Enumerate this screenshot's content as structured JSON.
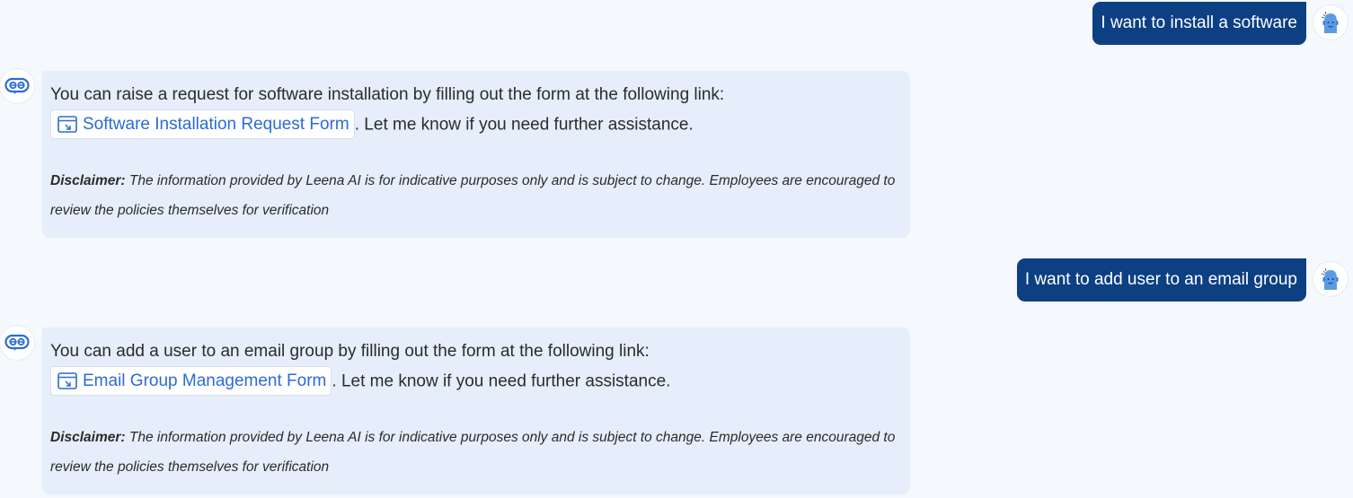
{
  "conversation": {
    "messages": [
      {
        "role": "user",
        "text": "I want to install a software",
        "avatar_icon": "user-mascot-icon"
      },
      {
        "role": "bot",
        "avatar_icon": "leena-ai-logo-icon",
        "intro": "You can raise a request for software installation by filling out the form at the following link:",
        "link_label": "Software Installation Request Form",
        "link_icon": "form-link-icon",
        "after_link": ". Let me know if you need further assistance.",
        "disclaimer_label": "Disclaimer:",
        "disclaimer_text": " The information provided by Leena AI is for indicative purposes only and is subject to change. Employees are encouraged to review the policies themselves for verification"
      },
      {
        "role": "user",
        "text": "I want to add user to an email group",
        "avatar_icon": "user-mascot-icon"
      },
      {
        "role": "bot",
        "avatar_icon": "leena-ai-logo-icon",
        "intro": "You can add a user to an email group by filling out the form at the following link:",
        "link_label": "Email Group Management Form",
        "link_icon": "form-link-icon",
        "after_link": ". Let me know if you need further assistance.",
        "disclaimer_label": "Disclaimer:",
        "disclaimer_text": " The information provided by Leena AI is for indicative purposes only and is subject to change. Employees are encouraged to review the policies themselves for verification"
      }
    ]
  },
  "colors": {
    "page_background": "#f5f8fd",
    "user_bubble": "#0d3f83",
    "bot_bubble": "#e5eefa",
    "link_text": "#2c6bd3"
  }
}
